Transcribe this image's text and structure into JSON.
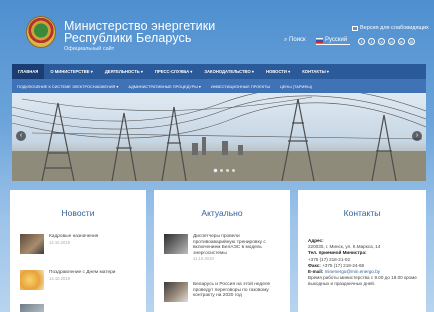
{
  "header": {
    "title_line1": "Министерство энергетики",
    "title_line2": "Республики Беларусь",
    "subtitle": "Официальный сайт",
    "a11y_label": "Версия для слабовидящих",
    "search_label": "Поиск",
    "language": "Русский",
    "socials": [
      "f",
      "t",
      "vk",
      "ok",
      "yt",
      "in"
    ]
  },
  "nav": {
    "items": [
      {
        "label": "ГЛАВНАЯ",
        "active": true
      },
      {
        "label": "О МИНИСТЕРСТВЕ ▾"
      },
      {
        "label": "ДЕЯТЕЛЬНОСТЬ ▾"
      },
      {
        "label": "ПРЕСС-СЛУЖБА ▾"
      },
      {
        "label": "ЗАКОНОДАТЕЛЬСТВО ▾"
      },
      {
        "label": "НОВОСТИ ▾"
      },
      {
        "label": "КОНТАКТЫ ▾"
      }
    ],
    "subitems": [
      "ПОДКЛЮЧЕНИЕ К СИСТЕМЕ ЭЛЕКТРОСНАБЖЕНИЯ ▾",
      "АДМИНИСТРАТИВНЫЕ ПРОЦЕДУРЫ ▾",
      "ИНВЕСТИЦИОННЫЕ ПРОЕКТЫ",
      "ЦЕНЫ (ТАРИФЫ)"
    ]
  },
  "slider": {
    "prev": "‹",
    "next": "›",
    "slides": 4,
    "active_slide": 1
  },
  "news": {
    "title": "Новости",
    "items": [
      {
        "text": "Кадровые назначения",
        "date": "14.10.2019"
      },
      {
        "text": "Поздравление с Днем матери",
        "date": "14.10.2019"
      },
      {
        "text": "",
        "date": ""
      }
    ]
  },
  "actual": {
    "title": "Актуально",
    "items": [
      {
        "text": "Диспетчеры провели противоаварийную тренировку с включением БелАЭС в модель энергосистемы",
        "date": "11.10.2019"
      },
      {
        "text": "Беларусь и Россия на этой неделе проведут переговоры по газовому контракту на 2020 год",
        "date": ""
      }
    ]
  },
  "contacts": {
    "title": "Контакты",
    "address_label": "Адрес:",
    "address": "220030, г. Минск, ул. К.Маркса, 14",
    "phone_label": "Тел. приемной Министра:",
    "phone": "+375 (17) 218-21-02",
    "fax_label": "Факс:",
    "fax": "+375 (17) 218-24-68",
    "email_label": "E-mail:",
    "email": "minenergo@min.energo.by",
    "hours": "Время работы министерства с 9.00 до 18.00 кроме выходных и праздничных дней."
  }
}
